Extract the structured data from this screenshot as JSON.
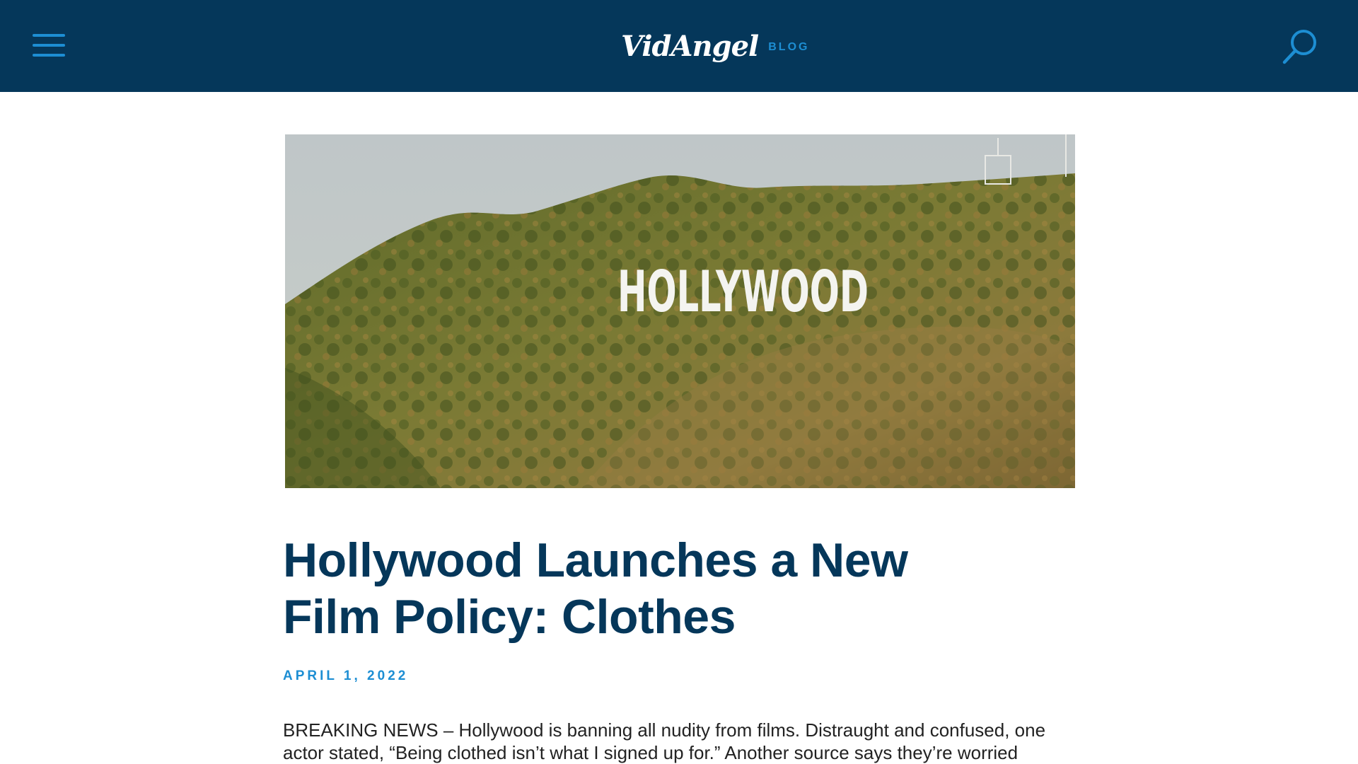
{
  "header": {
    "logo_text": "VidAngel",
    "section_tag": "BLOG",
    "menu_icon": "hamburger-menu-icon",
    "search_icon": "search-icon",
    "colors": {
      "header_bg": "#05375a",
      "accent": "#1d8ed3"
    }
  },
  "article": {
    "hero_image": {
      "subject": "hollywood-sign-on-hillside",
      "sign_text": "HOLLYWOOD"
    },
    "title": "Hollywood Launches a New Film Policy: Clothes",
    "date": "APRIL 1, 2022",
    "body": "BREAKING NEWS – Hollywood is banning all nudity from films. Distraught and confused, one actor stated, “Being clothed isn’t what I signed up for.” Another source says they’re worried"
  }
}
